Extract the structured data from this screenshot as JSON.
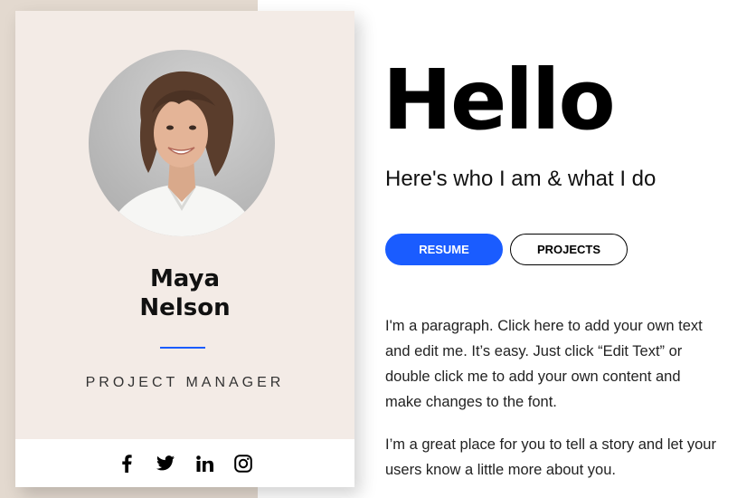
{
  "profile": {
    "first_name": "Maya",
    "last_name": "Nelson",
    "role": "PROJECT MANAGER"
  },
  "social": [
    {
      "name": "facebook",
      "icon": "facebook-icon"
    },
    {
      "name": "twitter",
      "icon": "twitter-icon"
    },
    {
      "name": "linkedin",
      "icon": "linkedin-icon"
    },
    {
      "name": "instagram",
      "icon": "instagram-icon"
    }
  ],
  "hero": {
    "title": "Hello",
    "subtitle": "Here's who I am & what I do"
  },
  "buttons": {
    "resume_label": "RESUME",
    "projects_label": "PROJECTS"
  },
  "about": {
    "paragraph1": "I'm a paragraph. Click here to add your own text and edit me. It’s easy. Just click “Edit Text” or double click me to add your own content and make changes to the font.",
    "paragraph2": "I’m a great place for you to tell a story and let your users know a little more about you."
  },
  "colors": {
    "accent": "#1a5cff",
    "card_bg": "#f3ebe6",
    "side_bg": "#e3d9cf"
  }
}
